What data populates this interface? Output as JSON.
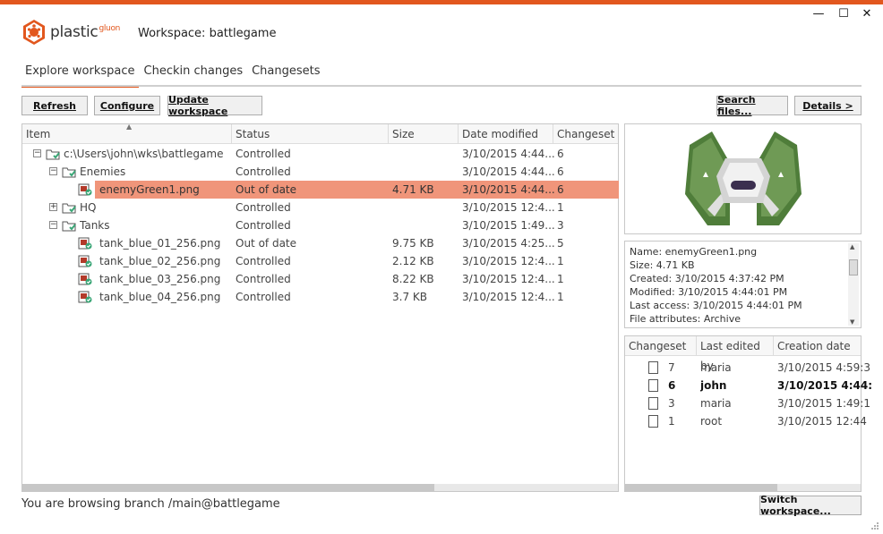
{
  "window": {
    "title": "Workspace: battlegame",
    "minimize": "—",
    "maximize": "☐",
    "close": "✕"
  },
  "logo": {
    "word": "plastic",
    "sup": "gluon"
  },
  "tabs": [
    {
      "label": "Explore workspace"
    },
    {
      "label": "Checkin changes"
    },
    {
      "label": "Changesets"
    }
  ],
  "toolbar": {
    "refresh": "Refresh",
    "configure": "Configure",
    "update": "Update workspace",
    "search": "Search files...",
    "details": "Details >"
  },
  "grid": {
    "headers": [
      "Item",
      "Status",
      "Size",
      "Date modified",
      "Changeset"
    ],
    "rows": [
      {
        "item": "c:\\Users\\john\\wks\\battlegame",
        "status": "Controlled",
        "size": "",
        "date": "3/10/2015 4:44...",
        "changeset": "6",
        "indent": 0,
        "expander": "−",
        "icon": "folder"
      },
      {
        "item": "Enemies",
        "status": "Controlled",
        "size": "",
        "date": "3/10/2015 4:44...",
        "changeset": "6",
        "indent": 1,
        "expander": "−",
        "icon": "folder"
      },
      {
        "item": "enemyGreen1.png",
        "status": "Out of date",
        "size": "4.71 KB",
        "date": "3/10/2015 4:44...",
        "changeset": "6",
        "indent": 2,
        "expander": "",
        "icon": "file",
        "selected": true
      },
      {
        "item": "HQ",
        "status": "Controlled",
        "size": "",
        "date": "3/10/2015 12:4...",
        "changeset": "1",
        "indent": 1,
        "expander": "+",
        "icon": "folder"
      },
      {
        "item": "Tanks",
        "status": "Controlled",
        "size": "",
        "date": "3/10/2015 1:49...",
        "changeset": "3",
        "indent": 1,
        "expander": "−",
        "icon": "folder"
      },
      {
        "item": "tank_blue_01_256.png",
        "status": "Out of date",
        "size": "9.75 KB",
        "date": "3/10/2015 4:25...",
        "changeset": "5",
        "indent": 2,
        "expander": "",
        "icon": "file"
      },
      {
        "item": "tank_blue_02_256.png",
        "status": "Controlled",
        "size": "2.12 KB",
        "date": "3/10/2015 12:4...",
        "changeset": "1",
        "indent": 2,
        "expander": "",
        "icon": "file"
      },
      {
        "item": "tank_blue_03_256.png",
        "status": "Controlled",
        "size": "8.22 KB",
        "date": "3/10/2015 12:4...",
        "changeset": "1",
        "indent": 2,
        "expander": "",
        "icon": "file"
      },
      {
        "item": "tank_blue_04_256.png",
        "status": "Controlled",
        "size": "3.7 KB",
        "date": "3/10/2015 12:4...",
        "changeset": "1",
        "indent": 2,
        "expander": "",
        "icon": "file"
      }
    ]
  },
  "details": {
    "name": "Name: enemyGreen1.png",
    "size": "Size: 4.71 KB",
    "created": "Created: 3/10/2015 4:37:42 PM",
    "modified": "Modified: 3/10/2015 4:44:01 PM",
    "last_access": "Last access: 3/10/2015 4:44:01 PM",
    "attributes": "File attributes: Archive"
  },
  "history": {
    "headers": [
      "Changeset",
      "Last edited by",
      "Creation date"
    ],
    "rows": [
      {
        "changeset": "7",
        "user": "maria",
        "date": "3/10/2015 4:59:3",
        "bold": false
      },
      {
        "changeset": "6",
        "user": "john",
        "date": "3/10/2015 4:44:",
        "bold": true
      },
      {
        "changeset": "3",
        "user": "maria",
        "date": "3/10/2015 1:49:1",
        "bold": false
      },
      {
        "changeset": "1",
        "user": "root",
        "date": "3/10/2015 12:44",
        "bold": false
      }
    ]
  },
  "status": {
    "text": "You are browsing branch /main@battlegame"
  },
  "switch_button": "Switch workspace...",
  "colors": {
    "accent": "#e2571e",
    "selected_row": "#f0957a",
    "folder_green": "#3aa676"
  }
}
